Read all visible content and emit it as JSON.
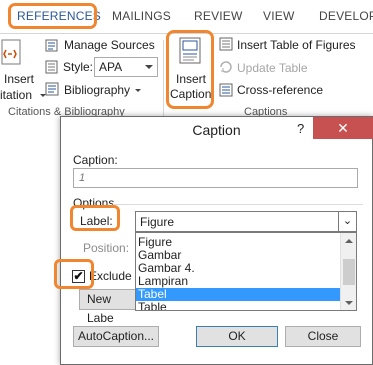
{
  "ribbon_tabs": [
    {
      "label": "REFERENCES",
      "active": true
    },
    {
      "label": "MAILINGS"
    },
    {
      "label": "REVIEW"
    },
    {
      "label": "VIEW"
    },
    {
      "label": "DEVELOPE"
    }
  ],
  "citations_group": {
    "insert_citation_label_1": "Insert",
    "insert_citation_label_2": "itation",
    "manage_sources": "Manage Sources",
    "style_label": "Style:",
    "style_value": "APA",
    "bibliography": "Bibliography",
    "group_label": "Citations & Bibliography"
  },
  "captions_group": {
    "insert_caption_1": "Insert",
    "insert_caption_2": "Caption",
    "insert_table_of_figures": "Insert Table of Figures",
    "update_table": "Update Table",
    "cross_reference": "Cross-reference",
    "group_label": "Captions"
  },
  "left_group_label": "Citations",
  "dialog": {
    "title": "Caption",
    "help": "?",
    "close": "✕",
    "caption_label": "Caption:",
    "caption_value": "1",
    "options_label": "Options",
    "label_label": "Label:",
    "label_value": "Figure",
    "position_label": "Position:",
    "exclude_label": "Exclude la",
    "exclude_checked": true,
    "new_label_button": "New Labe",
    "list_items": [
      "Figure",
      "Gambar",
      "Gambar 4.",
      "Lampiran",
      "Tabel",
      "Table"
    ],
    "selected_item": "Tabel",
    "autocaption_button": "AutoCaption...",
    "ok_button": "OK",
    "cancel_button": "Close"
  },
  "colors": {
    "highlight": "#f0862f",
    "active_tab": "#2b579a",
    "selection": "#3399ff",
    "close_button": "#c75050"
  }
}
